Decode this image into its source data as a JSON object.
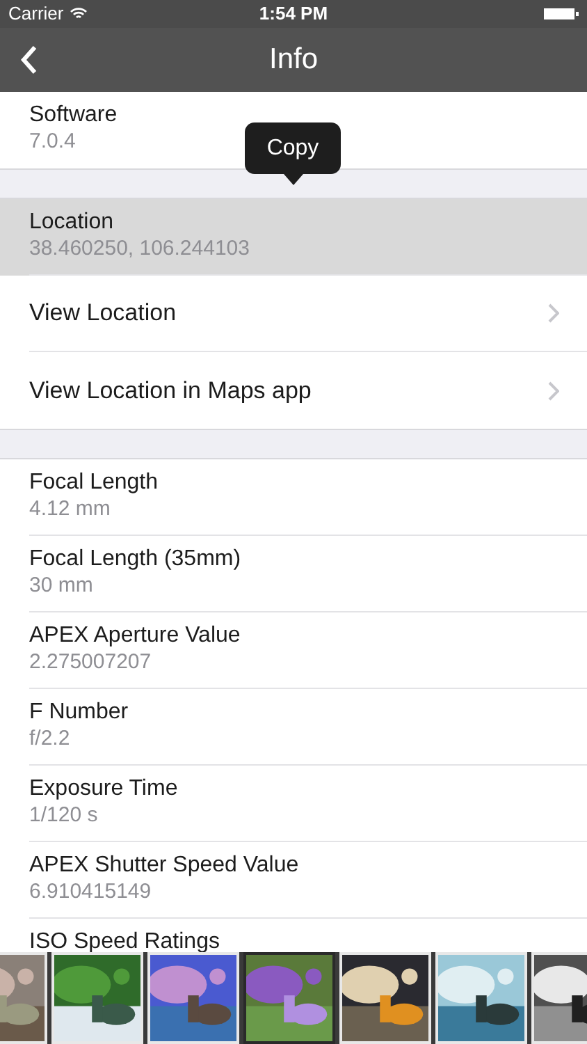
{
  "status_bar": {
    "carrier": "Carrier",
    "time": "1:54 PM"
  },
  "nav": {
    "title": "Info"
  },
  "tooltip": {
    "label": "Copy"
  },
  "sections": [
    {
      "rows": [
        {
          "kind": "info",
          "label": "Software",
          "value": "7.0.4",
          "selected": false
        }
      ]
    },
    {
      "rows": [
        {
          "kind": "info",
          "label": "Location",
          "value": "38.460250, 106.244103",
          "selected": true
        },
        {
          "kind": "link",
          "label": "View Location",
          "selected": false
        },
        {
          "kind": "link",
          "label": "View Location in Maps app",
          "selected": false
        }
      ]
    },
    {
      "rows": [
        {
          "kind": "info",
          "label": "Focal Length",
          "value": "4.12 mm",
          "selected": false
        },
        {
          "kind": "info",
          "label": "Focal Length (35mm)",
          "value": "30 mm",
          "selected": false
        },
        {
          "kind": "info",
          "label": "APEX Aperture Value",
          "value": "2.275007207",
          "selected": false
        },
        {
          "kind": "info",
          "label": "F Number",
          "value": "f/2.2",
          "selected": false
        },
        {
          "kind": "info",
          "label": "Exposure Time",
          "value": "1/120 s",
          "selected": false
        },
        {
          "kind": "info",
          "label": "APEX Shutter Speed Value",
          "value": "6.910415149",
          "selected": false
        },
        {
          "kind": "info",
          "label": "ISO Speed Ratings",
          "selected": false
        }
      ]
    }
  ],
  "thumbnails": [
    {
      "kind": "picture",
      "selected": false
    },
    {
      "kind": "picture",
      "selected": false
    },
    {
      "kind": "picture",
      "selected": false
    },
    {
      "kind": "picture",
      "selected": true
    },
    {
      "kind": "picture",
      "selected": false
    },
    {
      "kind": "picture",
      "selected": false
    },
    {
      "kind": "picture",
      "selected": false
    }
  ]
}
